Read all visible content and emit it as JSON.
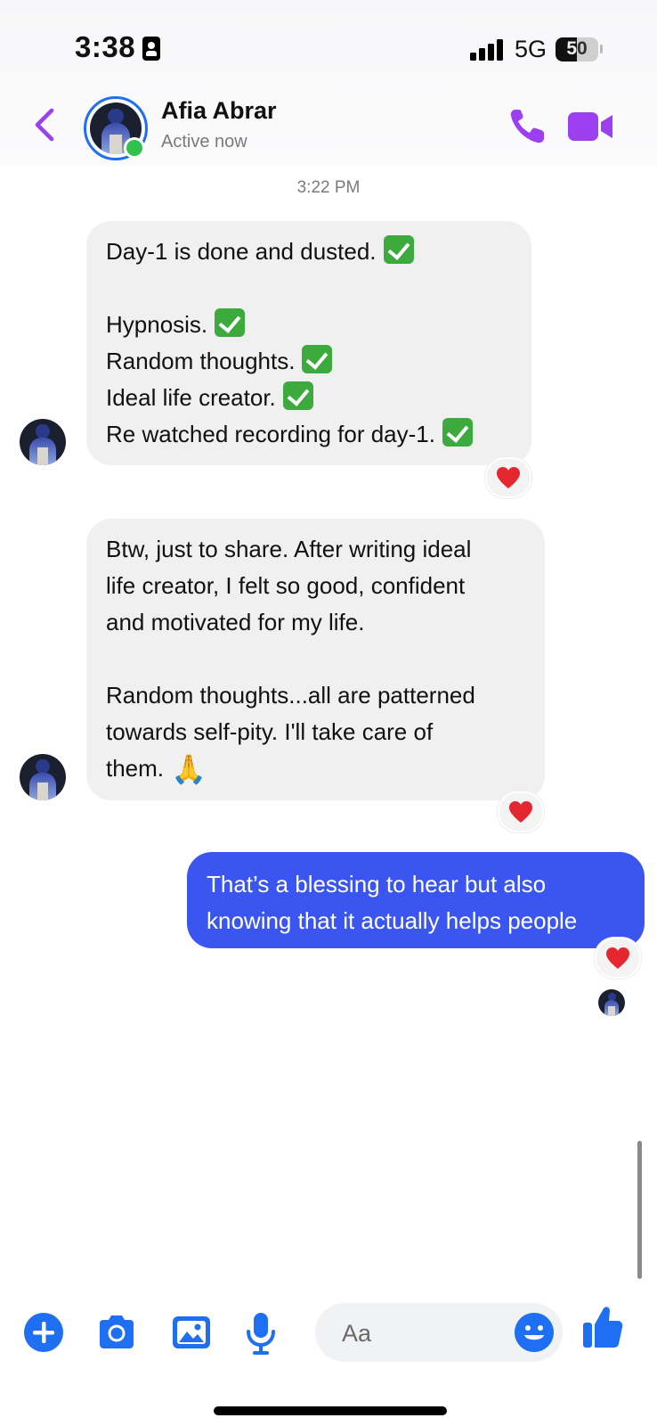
{
  "status_bar": {
    "time": "3:38",
    "network": "5G",
    "battery_level": "50"
  },
  "header": {
    "contact_name": "Afia Abrar",
    "contact_status": "Active now"
  },
  "conversation": {
    "timestamp": "3:22 PM",
    "message_1": {
      "lines": [
        "Day-1 is done and dusted.",
        "",
        "Hypnosis.",
        "Random thoughts.",
        "Ideal life creator.",
        "Re watched recording for day-1."
      ],
      "reaction": "heart"
    },
    "message_2": {
      "lines": [
        "Btw, just to share. After writing ideal",
        "life creator, I felt so good, confident",
        "and motivated for my life.",
        "",
        "Random thoughts...all are patterned",
        "towards self-pity. I'll take care of",
        "them."
      ],
      "emoji": "🙏",
      "reaction": "heart"
    },
    "message_3": {
      "lines": [
        "That’s a blessing to hear but also",
        "knowing that it actually helps people"
      ],
      "reaction": "heart"
    }
  },
  "composer": {
    "placeholder": "Aa"
  },
  "colors": {
    "accent_purple": "#9b3ff0",
    "outgoing_bubble": "#3b56f0",
    "incoming_bubble": "#f0f0f0",
    "action_blue": "#1e6ff2"
  }
}
